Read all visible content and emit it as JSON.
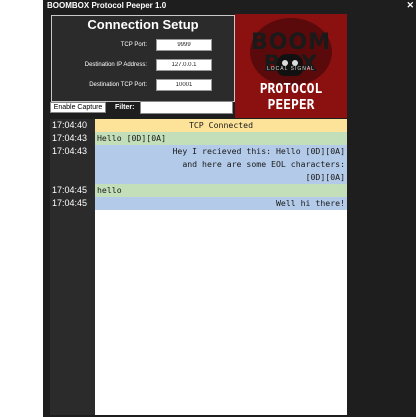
{
  "window": {
    "title": "BOOMBOX Protocol Peeper 1.0",
    "close_glyph": "✕"
  },
  "setup": {
    "heading": "Connection Setup",
    "fields": [
      {
        "label": "TCP Port:",
        "value": "9999"
      },
      {
        "label": "Destination IP Address:",
        "value": "127.0.0.1"
      },
      {
        "label": "Destination TCP Port:",
        "value": "10001"
      }
    ]
  },
  "logo": {
    "brand": "BOOMBOX",
    "brand_display": "BOOM BOX",
    "tagline": "LOCAL SIGNAL",
    "line1": "PROTOCOL",
    "line2": "PEEPER"
  },
  "controls": {
    "capture_label": "Enable Capture",
    "filter_label": "Filter:",
    "filter_value": ""
  },
  "colors": {
    "status": "#fde39a",
    "received": "#c3dfb9",
    "sent": "#b3cbe8",
    "logo_bg": "#8b1010",
    "chrome": "#1e1e1e"
  },
  "log": [
    {
      "time": "17:04:40",
      "kind": "status",
      "align": "center",
      "lines": [
        "TCP Connected"
      ]
    },
    {
      "time": "17:04:43",
      "kind": "received",
      "align": "left",
      "lines": [
        "Hello [0D][0A]"
      ]
    },
    {
      "time": "17:04:43",
      "kind": "sent",
      "align": "right",
      "lines": [
        "Hey I recieved this: Hello [0D][0A]",
        "and here are some EOL characters:",
        "[0D][0A]"
      ]
    },
    {
      "time": "17:04:45",
      "kind": "received",
      "align": "left",
      "lines": [
        "hello"
      ]
    },
    {
      "time": "17:04:45",
      "kind": "sent",
      "align": "right",
      "lines": [
        "Well hi there!"
      ]
    }
  ]
}
